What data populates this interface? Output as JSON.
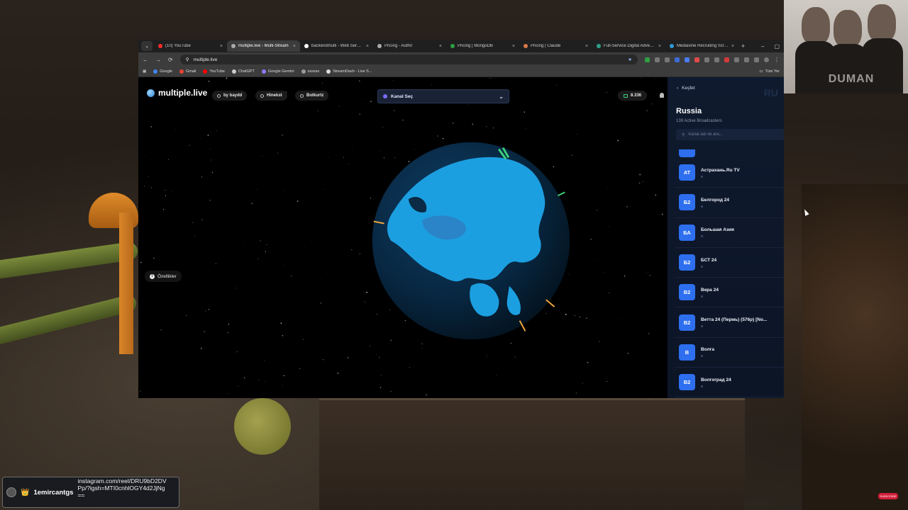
{
  "browser": {
    "tabs": [
      {
        "title": "(10) YouTube",
        "color": "#ff2b2b",
        "active": false
      },
      {
        "title": "multiple.live - Multi-Stream",
        "color": "#aaaaaa",
        "active": true
      },
      {
        "title": "backendmulti - Web Service",
        "color": "#ffffff",
        "active": false
      },
      {
        "title": "Pricing - Auth0",
        "color": "#aaaaaa",
        "active": false
      },
      {
        "title": "Pricing | MongoDB",
        "color": "#2ea043",
        "active": false
      },
      {
        "title": "Pricing | Claude",
        "color": "#d9774b",
        "active": false
      },
      {
        "title": "Full-Service Digital Advertising",
        "color": "#2ea089",
        "active": false
      },
      {
        "title": "Mediavine Recruiting Screen",
        "color": "#2e9bd6",
        "active": false
      }
    ],
    "url": "multiple.live",
    "bookmarks": [
      {
        "label": "Google",
        "color": "#4285f4"
      },
      {
        "label": "Gmail",
        "color": "#ea4335"
      },
      {
        "label": "YouTube",
        "color": "#ff0000"
      },
      {
        "label": "ChatGPT",
        "color": "#cccccc"
      },
      {
        "label": "Google Gemini",
        "color": "#8a7cff"
      },
      {
        "label": "ssssss",
        "color": "#999999"
      },
      {
        "label": "StreamDash - Live S...",
        "color": "#dddddd"
      }
    ],
    "all_bookmarks": "Tüm Yer"
  },
  "site": {
    "logo": "multiple.live",
    "nav": [
      "by baydd",
      "Hinekst",
      "Botkurtz"
    ],
    "channel_select": "Kanal Seç",
    "viewers": "8.336",
    "features_button": "Özellikler"
  },
  "panel": {
    "back_label": "Keşfet",
    "ghost_label": "RU",
    "country": "Russia",
    "subtitle": "139 Active Broadcasters",
    "search_placeholder": "Kanal adı ile ara...",
    "channels": [
      {
        "abbr": "AT",
        "name": "Астрахань.Ru TV"
      },
      {
        "abbr": "Б2",
        "name": "Белгород 24"
      },
      {
        "abbr": "БА",
        "name": "Большая Азия"
      },
      {
        "abbr": "Б2",
        "name": "БСТ 24"
      },
      {
        "abbr": "В2",
        "name": "Вера 24"
      },
      {
        "abbr": "В2",
        "name": "Ветта 24 (Пермь) (576p) [No..."
      },
      {
        "abbr": "В",
        "name": "Волга"
      },
      {
        "abbr": "В2",
        "name": "Волгоград 24"
      }
    ]
  },
  "webcam": {
    "logo": "DUMAN"
  },
  "chat": {
    "crown": "👑",
    "user": "1emircantgs",
    "message": "instagram.com/reel/DRU9bD2DVPp/?igsh=MTI0cnhlOGY4d2JjNg=="
  },
  "subscribe": "SUBSCRIBE"
}
